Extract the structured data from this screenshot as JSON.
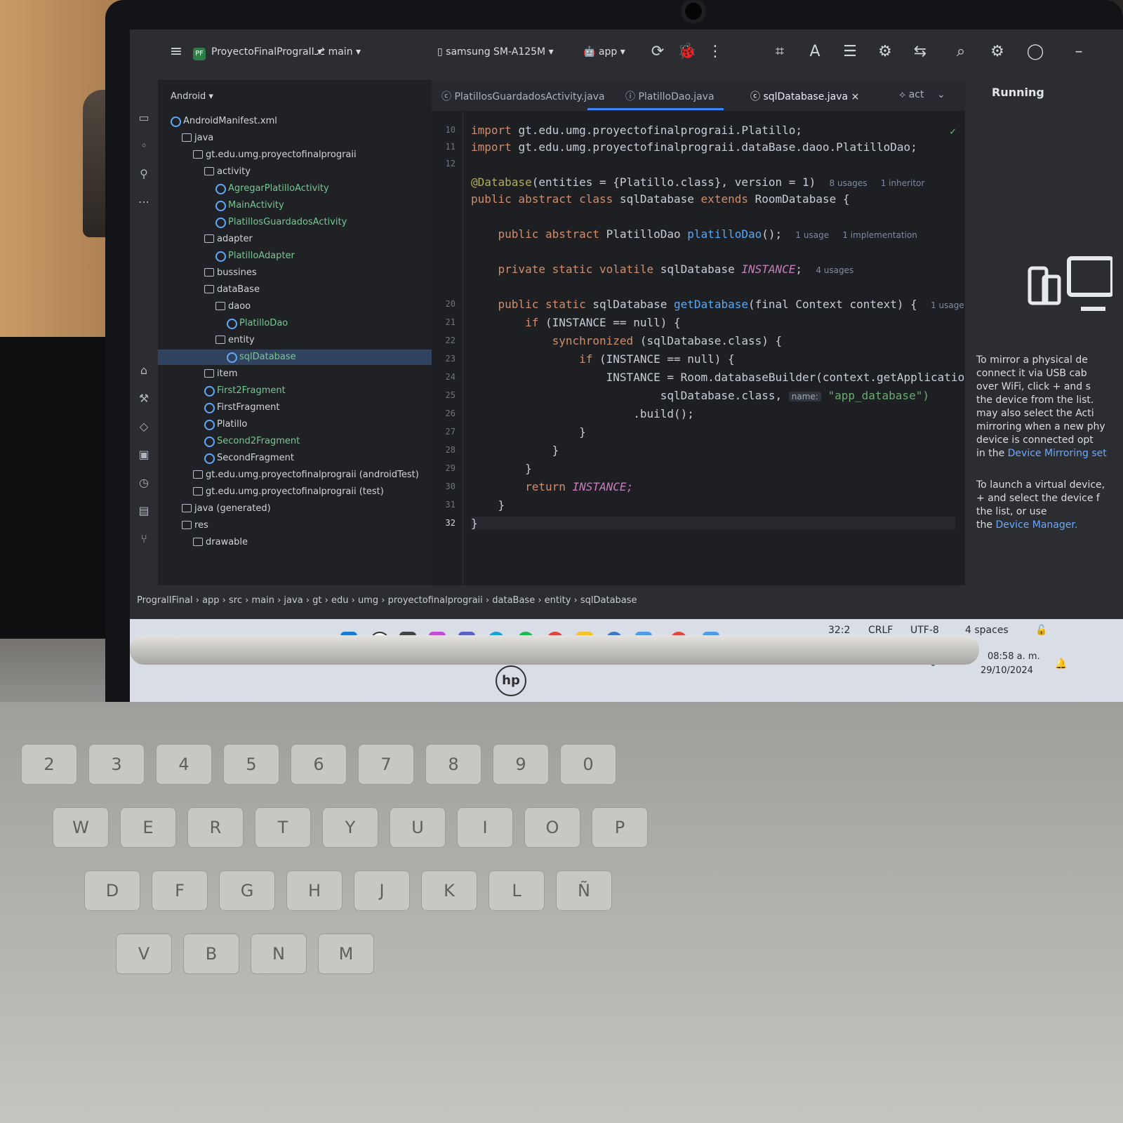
{
  "toolbar": {
    "project_badge": "PF",
    "project_name": "ProyectoFinalPrograII",
    "branch": "main",
    "device": "samsung SM-A125M",
    "run_config": "app"
  },
  "project_panel": {
    "title": "Android",
    "tree": [
      {
        "label": "AndroidManifest.xml",
        "type": "file",
        "indent": 0
      },
      {
        "label": "java",
        "type": "folder",
        "indent": 1
      },
      {
        "label": "gt.edu.umg.proyectofinalprograii",
        "type": "folder",
        "indent": 2
      },
      {
        "label": "activity",
        "type": "folder",
        "indent": 3
      },
      {
        "label": "AgregarPlatilloActivity",
        "type": "class",
        "indent": 4,
        "green": true
      },
      {
        "label": "MainActivity",
        "type": "class",
        "indent": 4,
        "green": true
      },
      {
        "label": "PlatillosGuardadosActivity",
        "type": "class",
        "indent": 4,
        "green": true
      },
      {
        "label": "adapter",
        "type": "folder",
        "indent": 3
      },
      {
        "label": "PlatilloAdapter",
        "type": "class",
        "indent": 4,
        "green": true
      },
      {
        "label": "bussines",
        "type": "folder",
        "indent": 3
      },
      {
        "label": "dataBase",
        "type": "folder",
        "indent": 3
      },
      {
        "label": "daoo",
        "type": "folder",
        "indent": 4
      },
      {
        "label": "PlatilloDao",
        "type": "class",
        "indent": 5,
        "green": true
      },
      {
        "label": "entity",
        "type": "folder",
        "indent": 4
      },
      {
        "label": "sqlDatabase",
        "type": "class",
        "indent": 5,
        "green": true,
        "selected": true
      },
      {
        "label": "item",
        "type": "folder",
        "indent": 3
      },
      {
        "label": "First2Fragment",
        "type": "class",
        "indent": 3,
        "green": true
      },
      {
        "label": "FirstFragment",
        "type": "class",
        "indent": 3
      },
      {
        "label": "Platillo",
        "type": "class",
        "indent": 3
      },
      {
        "label": "Second2Fragment",
        "type": "class",
        "indent": 3,
        "green": true
      },
      {
        "label": "SecondFragment",
        "type": "class",
        "indent": 3
      },
      {
        "label": "gt.edu.umg.proyectofinalprograii (androidTest)",
        "type": "folder",
        "indent": 2
      },
      {
        "label": "gt.edu.umg.proyectofinalprograii (test)",
        "type": "folder",
        "indent": 2
      },
      {
        "label": "java (generated)",
        "type": "folder",
        "indent": 1
      },
      {
        "label": "res",
        "type": "folder",
        "indent": 1
      },
      {
        "label": "drawable",
        "type": "folder",
        "indent": 2
      }
    ]
  },
  "tabs": {
    "tab1": "PlatillosGuardadosActivity.java",
    "tab2": "PlatilloDao.java",
    "tab3": "sqlDatabase.java",
    "tab4": "act"
  },
  "editor": {
    "lines": {
      "l10": "10",
      "l11": "11",
      "l12": "12",
      "l20": "20",
      "l21": "21",
      "l22": "22",
      "l23": "23",
      "l24": "24",
      "l25": "25",
      "l26": "26",
      "l27": "27",
      "l28": "28",
      "l29": "29",
      "l30": "30",
      "l31": "31",
      "l32": "32"
    },
    "code": {
      "import1_kw": "import",
      "import1_path": "gt.edu.umg.proyectofinalprograii.Platillo;",
      "import2_kw": "import",
      "import2_path": "gt.edu.umg.proyectofinalprograii.dataBase.daoo.PlatilloDao;",
      "annotation": "@Database",
      "annotation_args": "(entities = {Platillo.class}, version = 1)",
      "hint1": "8 usages",
      "hint1b": "1 inheritor",
      "class_decl_kw": "public abstract class",
      "class_name": "sqlDatabase",
      "class_extends_kw": "extends",
      "class_super": "RoomDatabase {",
      "dao_kw": "public abstract",
      "dao_type": "PlatilloDao",
      "dao_name": "platilloDao",
      "dao_tail": "();",
      "hint2": "1 usage",
      "hint2b": "1 implementation",
      "inst_kw": "private static volatile",
      "inst_type": "sqlDatabase",
      "inst_name": "INSTANCE",
      "inst_tail": ";",
      "hint3": "4 usages",
      "get_kw": "public static",
      "get_type": "sqlDatabase",
      "get_name": "getDatabase",
      "get_args": "(final Context context) {",
      "hint4": "1 usage",
      "if1_kw": "if",
      "if1_cond": "(INSTANCE == null) {",
      "sync_kw": "synchronized",
      "sync_cond": "(sqlDatabase.class) {",
      "if2_kw": "if",
      "if2_cond": "(INSTANCE == null) {",
      "assign": "INSTANCE = Room.databaseBuilder(context.getApplicationCont",
      "builder_arg": "sqlDatabase.class,",
      "name_hint": "name:",
      "db_name": "\"app_database\")",
      "build": ".build();",
      "close1": "}",
      "close2": "}",
      "close3": "}",
      "return_kw": "return",
      "return_val": "INSTANCE;",
      "close4": "}",
      "close5": "}"
    }
  },
  "right_panel": {
    "title": "Running",
    "p1_a": "To mirror a physical de",
    "p1_b": "connect it via USB cab",
    "p1_c": "over WiFi, click",
    "p1_d": "and s",
    "p1_e": "the device from the list.",
    "p1_f": "may also select the Acti",
    "p1_g": "mirroring when a new phy",
    "p1_h": "device is connected opt",
    "p1_i": "in the",
    "p1_link": "Device Mirroring set",
    "p2_a": "To launch a virtual device,",
    "p2_b": "and select the device f",
    "p2_c": "the list, or use",
    "p2_d": "the",
    "p2_link": "Device Manager."
  },
  "breadcrumb": [
    "ProgralIFinal",
    "app",
    "src",
    "main",
    "java",
    "gt",
    "edu",
    "umg",
    "proyectofinalprograii",
    "dataBase",
    "entity",
    "sqlDatabase"
  ],
  "status": {
    "position": "32:2",
    "line_ending": "CRLF",
    "encoding": "UTF-8",
    "indent": "4 spaces",
    "time": "08:58 a. m.",
    "date": "29/10/2024"
  },
  "keyboard": {
    "row1": [
      "2",
      "3",
      "4",
      "5",
      "6",
      "7",
      "8",
      "9",
      "0"
    ],
    "row2": [
      "W",
      "E",
      "R",
      "T",
      "Y",
      "U",
      "I",
      "O",
      "P"
    ],
    "row3": [
      "D",
      "F",
      "G",
      "H",
      "J",
      "K",
      "L",
      "Ñ"
    ],
    "row4": [
      "V",
      "B",
      "N",
      "M"
    ],
    "brand": "hp"
  },
  "colors": {
    "accent": "#3d87ff",
    "green_file": "#73c991",
    "editor_bg": "#1e1f22",
    "toolbar_bg": "#2b2d30"
  }
}
